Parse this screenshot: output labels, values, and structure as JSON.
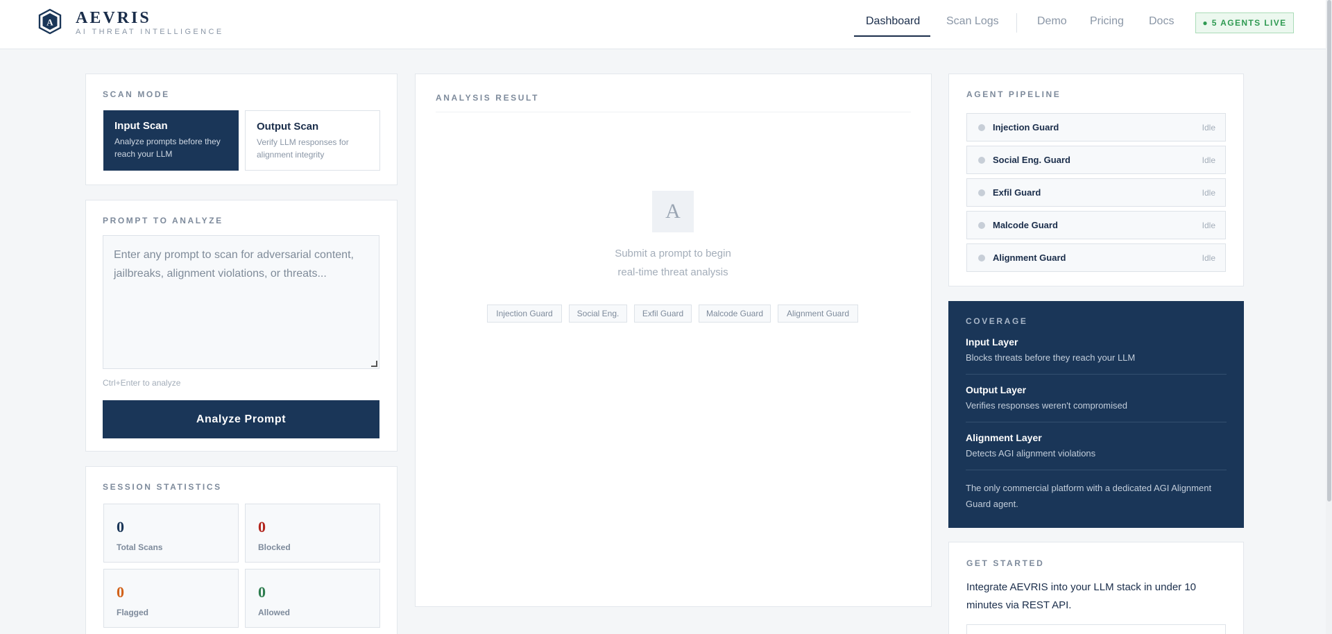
{
  "brand": {
    "name": "AEVRIS",
    "tagline": "AI THREAT INTELLIGENCE",
    "logo_letter": "A"
  },
  "nav": {
    "items": [
      {
        "label": "Dashboard",
        "active": true
      },
      {
        "label": "Scan Logs",
        "active": false
      },
      {
        "label": "Demo",
        "active": false
      },
      {
        "label": "Pricing",
        "active": false
      },
      {
        "label": "Docs",
        "active": false
      }
    ],
    "agents_live": "● 5 AGENTS LIVE"
  },
  "scan_mode": {
    "label": "SCAN MODE",
    "options": [
      {
        "title": "Input Scan",
        "description": "Analyze prompts before they reach your LLM",
        "selected": true
      },
      {
        "title": "Output Scan",
        "description": "Verify LLM responses for alignment integrity",
        "selected": false
      }
    ]
  },
  "prompt": {
    "label": "PROMPT TO ANALYZE",
    "placeholder": "Enter any prompt to scan for adversarial content, jailbreaks, alignment violations, or threats...",
    "hint": "Ctrl+Enter to analyze",
    "button": "Analyze Prompt"
  },
  "stats": {
    "label": "SESSION STATISTICS",
    "items": [
      {
        "value": "0",
        "label": "Total Scans",
        "color": "#1a3658"
      },
      {
        "value": "0",
        "label": "Blocked",
        "color": "#b3261e"
      },
      {
        "value": "0",
        "label": "Flagged",
        "color": "#d2621a"
      },
      {
        "value": "0",
        "label": "Allowed",
        "color": "#2e7d4f"
      }
    ]
  },
  "analysis": {
    "label": "ANALYSIS RESULT",
    "icon_letter": "A",
    "empty_line1": "Submit a prompt to begin",
    "empty_line2": "real-time threat analysis",
    "guards": [
      "Injection Guard",
      "Social Eng.",
      "Exfil Guard",
      "Malcode Guard",
      "Alignment Guard"
    ]
  },
  "pipeline": {
    "label": "AGENT PIPELINE",
    "agents": [
      {
        "name": "Injection Guard",
        "status": "Idle"
      },
      {
        "name": "Social Eng. Guard",
        "status": "Idle"
      },
      {
        "name": "Exfil Guard",
        "status": "Idle"
      },
      {
        "name": "Malcode Guard",
        "status": "Idle"
      },
      {
        "name": "Alignment Guard",
        "status": "Idle"
      }
    ]
  },
  "coverage": {
    "label": "COVERAGE",
    "layers": [
      {
        "title": "Input Layer",
        "description": "Blocks threats before they reach your LLM"
      },
      {
        "title": "Output Layer",
        "description": "Verifies responses weren't compromised"
      },
      {
        "title": "Alignment Layer",
        "description": "Detects AGI alignment violations"
      }
    ],
    "note": "The only commercial platform with a dedicated AGI Alignment Guard agent."
  },
  "get_started": {
    "label": "GET STARTED",
    "text": "Integrate AEVRIS into your LLM stack in under 10 minutes via REST API."
  },
  "colors": {
    "navy": "#1a3658",
    "live_green": "#2f9a52"
  }
}
